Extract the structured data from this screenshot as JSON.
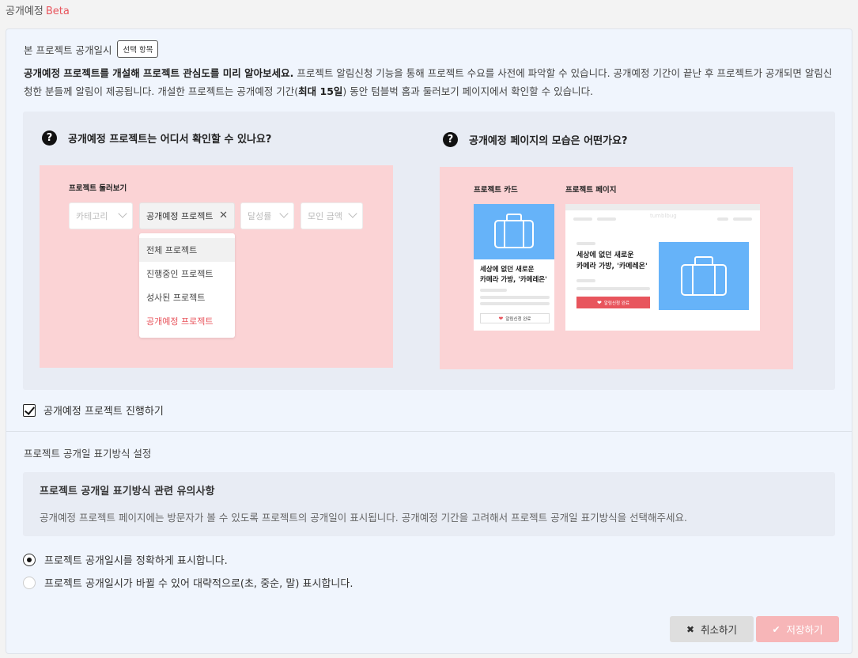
{
  "header": {
    "title": "공개예정",
    "badge": "Beta"
  },
  "section1": {
    "title": "본 프로젝트 공개일시",
    "tag": "선택 항목",
    "desc_bold": "공개예정 프로젝트를 개설해 프로젝트 관심도를 미리 알아보세요.",
    "desc_1": " 프로젝트 알림신청 기능을 통해 프로젝트 수요를 사전에 파악할 수 있습니다. 공개예정 기간이 끝난 후 프로젝트가 공개되면 알림신청한 분들께 알림이 제공됩니다. 개설한 프로젝트는 공개예정 기간(",
    "desc_bold2": "최대 15일",
    "desc_2": ") 동안 텀블벅 홈과 둘러보기 페이지에서 확인할 수 있습니다.",
    "q1": "공개예정 프로젝트는 어디서 확인할 수 있나요?",
    "q2": "공개예정 페이지의 모습은 어떤가요?",
    "q_icon": "?",
    "illus1": {
      "label": "프로젝트 둘러보기",
      "filters": [
        "카테고리",
        "공개예정 프로젝트",
        "달성률",
        "모인 금액"
      ],
      "options": [
        "전체 프로젝트",
        "진행중인 프로젝트",
        "성사된 프로젝트",
        "공개예정 프로젝트"
      ]
    },
    "illus2": {
      "label_card": "프로젝트 카드",
      "label_page": "프로젝트 페이지",
      "title_l1": "세상에 없던 새로운",
      "title_l2": "카메라 가방, '카메레온'",
      "btn": "알림신청 완료",
      "logo": "tumblbug"
    },
    "checkbox_label": "공개예정 프로젝트 진행하기"
  },
  "section2": {
    "title": "프로젝트 공개일 표기방식 설정",
    "notice_title": "프로젝트 공개일 표기방식 관련 유의사항",
    "notice_body": "공개예정 프로젝트 페이지에는 방문자가 볼 수 있도록 프로젝트의 공개일이 표시됩니다. 공개예정 기간을 고려해서 프로젝트 공개일 표기방식을 선택해주세요.",
    "radio1": "프로젝트 공개일시를 정확하게 표시합니다.",
    "radio2": "프로젝트 공개일시가 바뀔 수 있어 대략적으로(초, 중순, 말) 표시합니다."
  },
  "buttons": {
    "cancel": "취소하기",
    "save": "저장하기",
    "cancel_icon": "✖",
    "save_icon": "✔"
  },
  "colors": {
    "accent": "#e8555d",
    "illustration_bg": "#fbd3d5",
    "blue": "#66b3f9"
  }
}
